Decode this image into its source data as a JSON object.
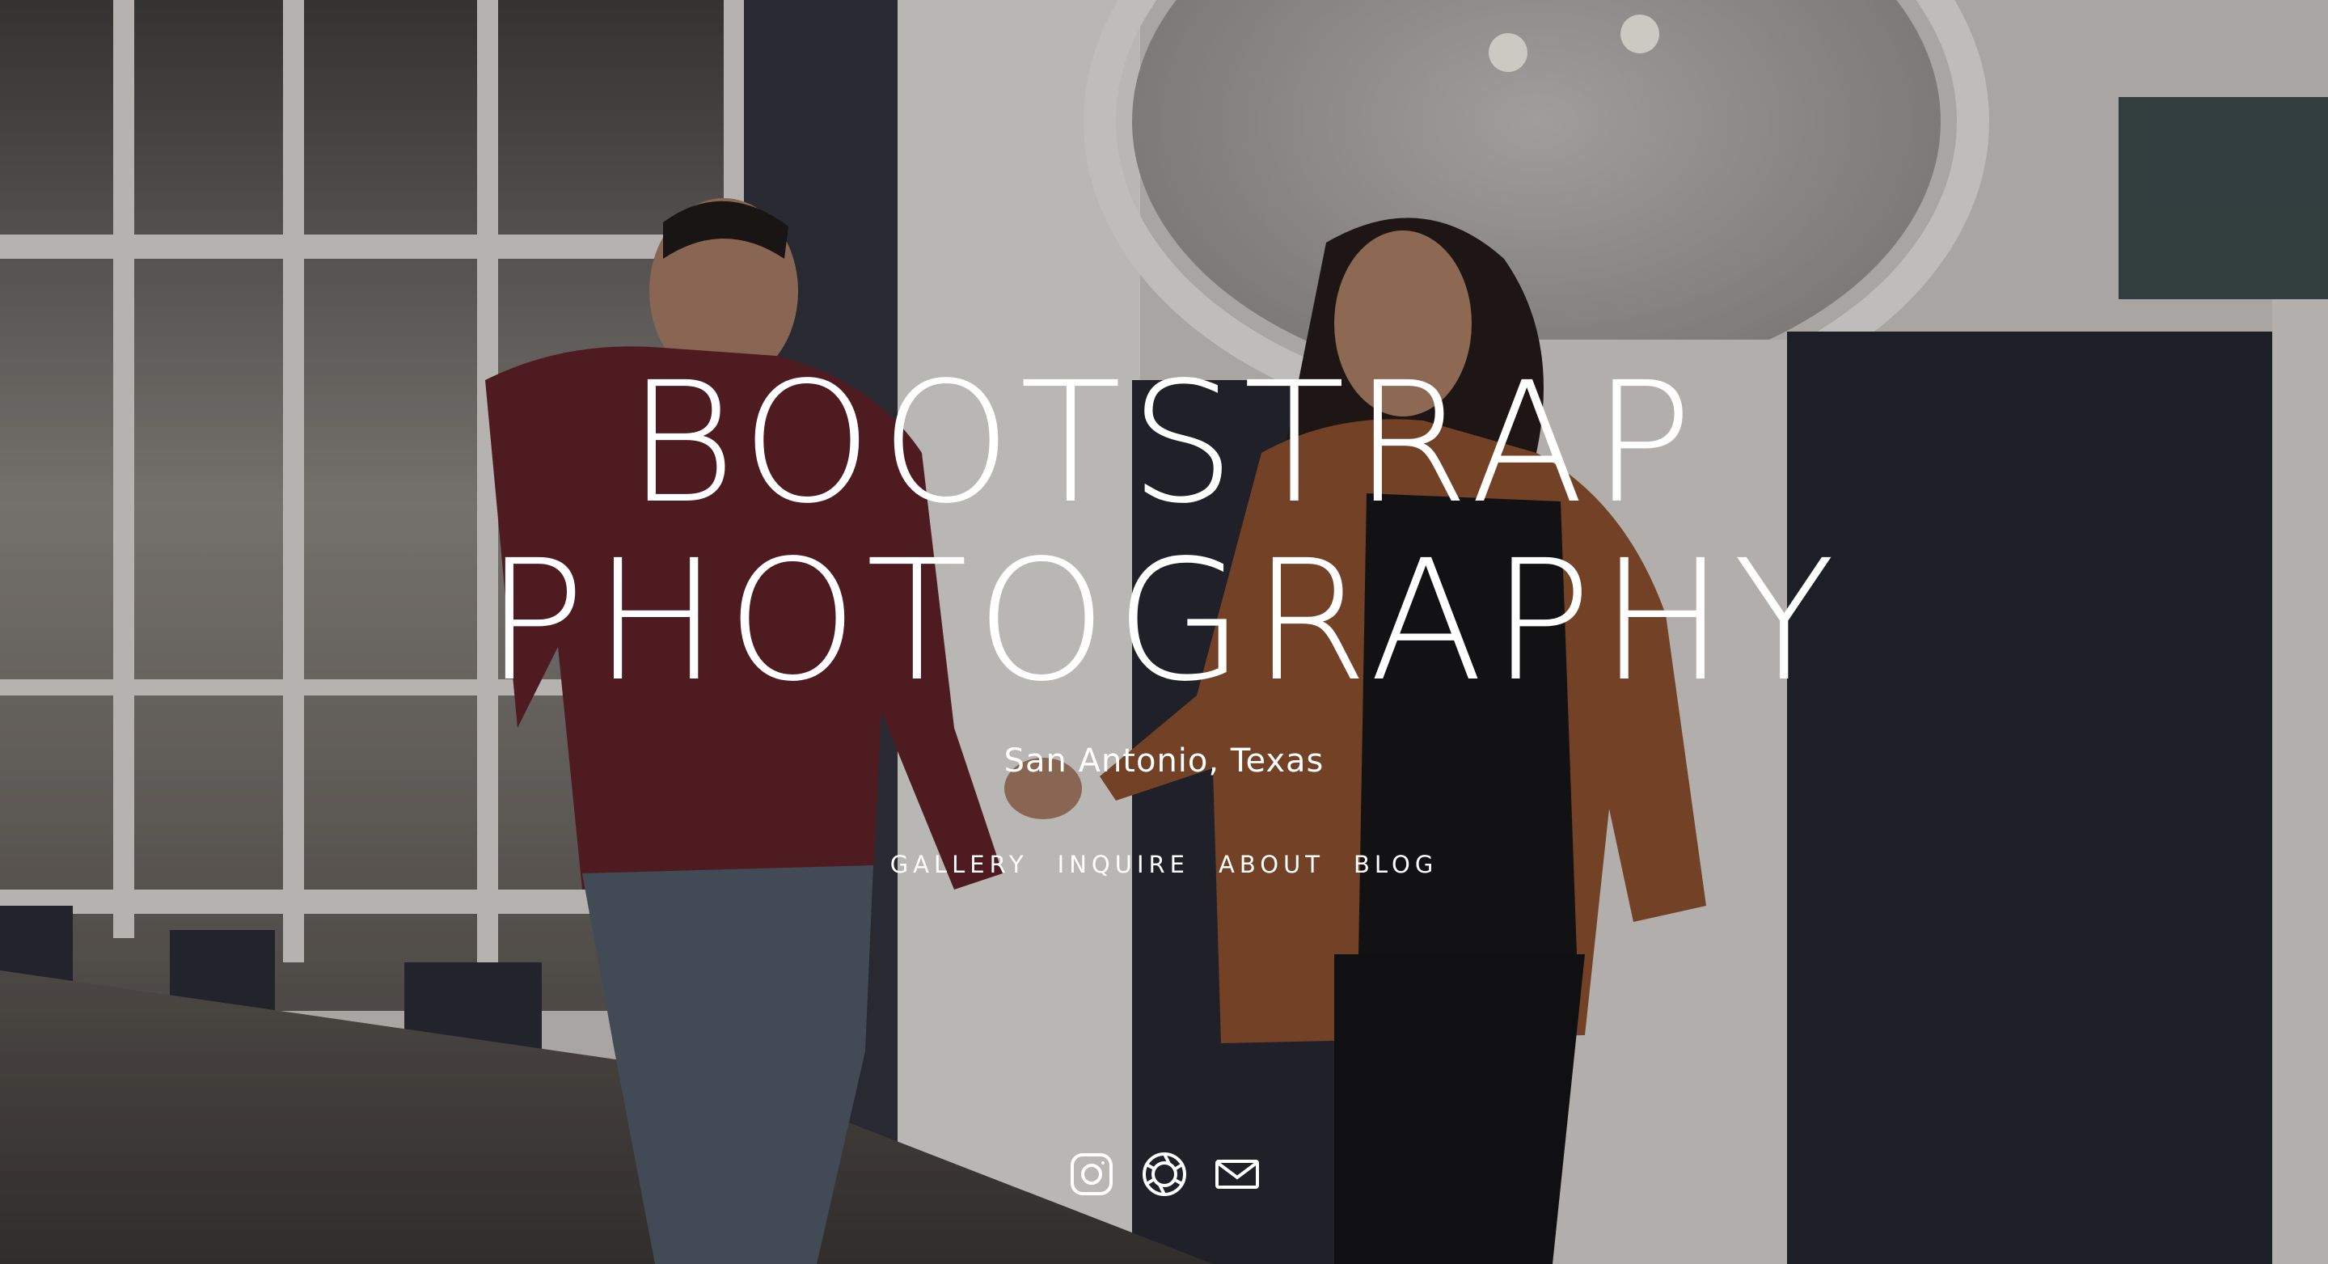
{
  "site": {
    "title_line1": "BOOTSTRAP",
    "title_line2": "PHOTOGRAPHY",
    "location": "San Antonio, Texas"
  },
  "nav": {
    "items": [
      {
        "label": "GALLERY"
      },
      {
        "label": "INQUIRE"
      },
      {
        "label": "ABOUT"
      },
      {
        "label": "BLOG"
      }
    ]
  },
  "social": {
    "icons": [
      "instagram-icon",
      "aperture-icon",
      "mail-icon"
    ]
  },
  "colors": {
    "text": "#ffffff",
    "wall_dark": "#24262f",
    "wall_light": "#d9d6d2"
  }
}
